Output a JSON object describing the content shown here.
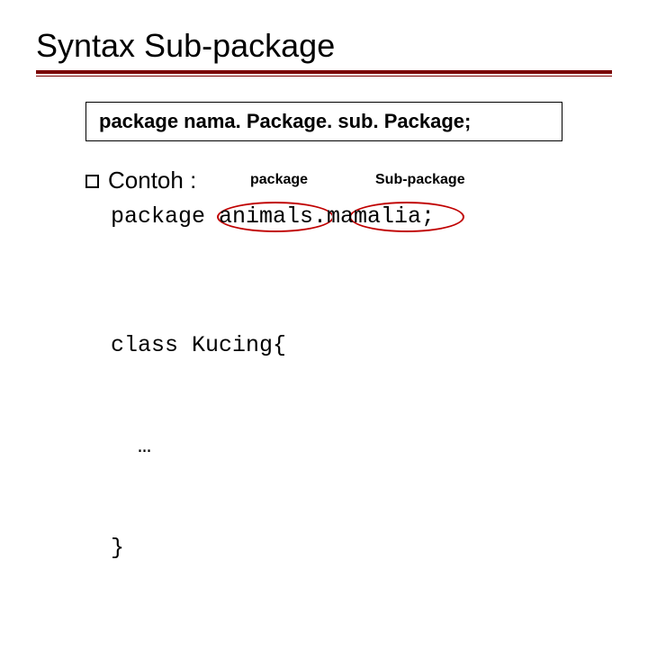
{
  "title": "Syntax Sub-package",
  "syntax_box": "package nama. Package. sub. Package;",
  "bullet_label": "Contoh :",
  "annotations": {
    "package": "package",
    "subpackage": "Sub-package"
  },
  "code": {
    "pkg_line": "package animals.mamalia;",
    "class_line1": "class Kucing{",
    "class_line2": "  …",
    "class_line3": "}"
  }
}
